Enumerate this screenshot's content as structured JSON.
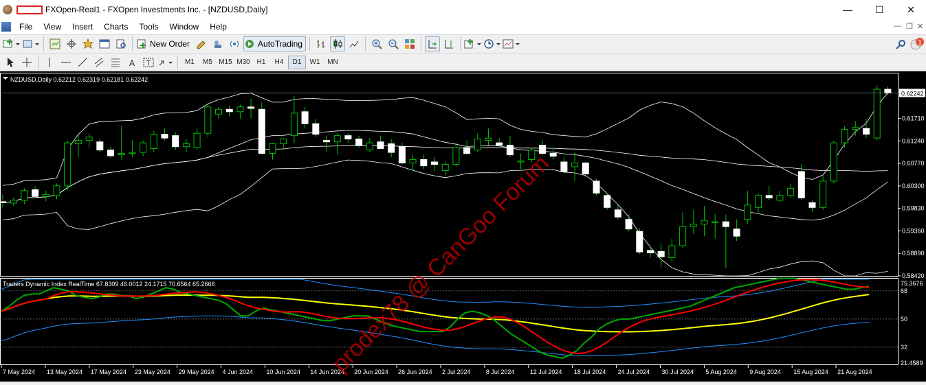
{
  "window": {
    "title": "FXOpen-Real1 - FXOpen Investments Inc. - [NZDUSD,Daily]"
  },
  "menu": [
    "File",
    "View",
    "Insert",
    "Charts",
    "Tools",
    "Window",
    "Help"
  ],
  "toolbar": {
    "new_order_label": "New Order",
    "autotrading_label": "AutoTrading",
    "notification_count": "1"
  },
  "timeframes": [
    "M1",
    "M5",
    "M15",
    "M30",
    "H1",
    "H4",
    "D1",
    "W1",
    "MN"
  ],
  "active_timeframe": "D1",
  "chart": {
    "header": "NZDUSD,Daily  0.62212 0.62319 0.62181 0.62242",
    "current_price": "0.62242",
    "price_labels": [
      "0.62242",
      "0.61710",
      "0.61240",
      "0.60770",
      "0.60300",
      "0.59830",
      "0.59360",
      "0.58890",
      "0.58420"
    ],
    "indicator_header": "Traders Dynamic Index RealTime 67.8309 46.0012 24.1715 70.6564 65.2666",
    "indicator_labels": [
      "75.3676",
      "68",
      "50",
      "32",
      "21.4589"
    ],
    "date_labels": [
      "7 May 2024",
      "13 May 2024",
      "17 May 2024",
      "23 May 2024",
      "29 May 2024",
      "4 Jun 2024",
      "10 Jun 2024",
      "14 Jun 2024",
      "20 Jun 2024",
      "26 Jun 2024",
      "2 Jul 2024",
      "8 Jul 2024",
      "12 Jul 2024",
      "18 Jul 2024",
      "24 Jul 2024",
      "30 Jul 2024",
      "5 Aug 2024",
      "9 Aug 2024",
      "15 Aug 2024",
      "21 Aug 2024"
    ],
    "watermark": "prodex78 @ CanGoo Forum",
    "colors": {
      "background": "#000000",
      "candle_bull": "#000000",
      "candle_bear": "#ffffff",
      "candle_outline": "#ffffff",
      "doji_green": "#00c000",
      "bands": "#ffffff",
      "tdi_green": "#00aa00",
      "tdi_red": "#ff0000",
      "tdi_yellow": "#ffff00",
      "tdi_blue": "#1e90ff",
      "watermark": "#cc0000"
    }
  },
  "chart_data": {
    "type": "candlestick",
    "symbol": "NZDUSD",
    "timeframe": "Daily",
    "ylim": [
      0.5842,
      0.6265
    ],
    "candles": [
      {
        "o": 0.5997,
        "h": 0.6012,
        "l": 0.5985,
        "c": 0.5995
      },
      {
        "o": 0.5994,
        "h": 0.6005,
        "l": 0.5988,
        "c": 0.6
      },
      {
        "o": 0.6,
        "h": 0.6025,
        "l": 0.5992,
        "c": 0.602
      },
      {
        "o": 0.6022,
        "h": 0.603,
        "l": 0.6005,
        "c": 0.6008
      },
      {
        "o": 0.6008,
        "h": 0.602,
        "l": 0.5998,
        "c": 0.6012
      },
      {
        "o": 0.601,
        "h": 0.6035,
        "l": 0.6002,
        "c": 0.603
      },
      {
        "o": 0.603,
        "h": 0.6125,
        "l": 0.602,
        "c": 0.612
      },
      {
        "o": 0.6118,
        "h": 0.6135,
        "l": 0.609,
        "c": 0.6125
      },
      {
        "o": 0.6125,
        "h": 0.614,
        "l": 0.611,
        "c": 0.6132
      },
      {
        "o": 0.6122,
        "h": 0.6128,
        "l": 0.61,
        "c": 0.6105
      },
      {
        "o": 0.6105,
        "h": 0.6112,
        "l": 0.6088,
        "c": 0.6093
      },
      {
        "o": 0.6095,
        "h": 0.6155,
        "l": 0.6085,
        "c": 0.6098
      },
      {
        "o": 0.6098,
        "h": 0.6125,
        "l": 0.609,
        "c": 0.61
      },
      {
        "o": 0.61,
        "h": 0.6125,
        "l": 0.6092,
        "c": 0.612
      },
      {
        "o": 0.6108,
        "h": 0.6145,
        "l": 0.61,
        "c": 0.6138
      },
      {
        "o": 0.6138,
        "h": 0.615,
        "l": 0.6125,
        "c": 0.613
      },
      {
        "o": 0.6135,
        "h": 0.6142,
        "l": 0.6105,
        "c": 0.6112
      },
      {
        "o": 0.6112,
        "h": 0.6128,
        "l": 0.61,
        "c": 0.6118
      },
      {
        "o": 0.611,
        "h": 0.615,
        "l": 0.6105,
        "c": 0.614
      },
      {
        "o": 0.614,
        "h": 0.62,
        "l": 0.6132,
        "c": 0.6195
      },
      {
        "o": 0.618,
        "h": 0.6195,
        "l": 0.617,
        "c": 0.619
      },
      {
        "o": 0.619,
        "h": 0.6198,
        "l": 0.6175,
        "c": 0.6185
      },
      {
        "o": 0.6185,
        "h": 0.62,
        "l": 0.617,
        "c": 0.6195
      },
      {
        "o": 0.6195,
        "h": 0.6212,
        "l": 0.617,
        "c": 0.6192
      },
      {
        "o": 0.619,
        "h": 0.6205,
        "l": 0.6095,
        "c": 0.6098
      },
      {
        "o": 0.6098,
        "h": 0.612,
        "l": 0.6085,
        "c": 0.6118
      },
      {
        "o": 0.6118,
        "h": 0.613,
        "l": 0.6105,
        "c": 0.6128
      },
      {
        "o": 0.6135,
        "h": 0.6218,
        "l": 0.612,
        "c": 0.6182
      },
      {
        "o": 0.6185,
        "h": 0.6195,
        "l": 0.615,
        "c": 0.616
      },
      {
        "o": 0.616,
        "h": 0.617,
        "l": 0.6132,
        "c": 0.6138
      },
      {
        "o": 0.6125,
        "h": 0.6135,
        "l": 0.61,
        "c": 0.6122
      },
      {
        "o": 0.6122,
        "h": 0.614,
        "l": 0.6095,
        "c": 0.6135
      },
      {
        "o": 0.6135,
        "h": 0.614,
        "l": 0.612,
        "c": 0.6128
      },
      {
        "o": 0.6128,
        "h": 0.6135,
        "l": 0.611,
        "c": 0.6115
      },
      {
        "o": 0.6105,
        "h": 0.613,
        "l": 0.61,
        "c": 0.612
      },
      {
        "o": 0.6122,
        "h": 0.6135,
        "l": 0.611,
        "c": 0.6108
      },
      {
        "o": 0.6118,
        "h": 0.6128,
        "l": 0.609,
        "c": 0.61
      },
      {
        "o": 0.6112,
        "h": 0.612,
        "l": 0.6075,
        "c": 0.6078
      },
      {
        "o": 0.6078,
        "h": 0.6095,
        "l": 0.606,
        "c": 0.6085
      },
      {
        "o": 0.6085,
        "h": 0.6095,
        "l": 0.6065,
        "c": 0.6072
      },
      {
        "o": 0.608,
        "h": 0.609,
        "l": 0.606,
        "c": 0.6075
      },
      {
        "o": 0.6062,
        "h": 0.608,
        "l": 0.6052,
        "c": 0.6075
      },
      {
        "o": 0.6075,
        "h": 0.612,
        "l": 0.607,
        "c": 0.611
      },
      {
        "o": 0.611,
        "h": 0.6125,
        "l": 0.6095,
        "c": 0.6098
      },
      {
        "o": 0.6105,
        "h": 0.614,
        "l": 0.61,
        "c": 0.6128
      },
      {
        "o": 0.6125,
        "h": 0.615,
        "l": 0.6115,
        "c": 0.613
      },
      {
        "o": 0.612,
        "h": 0.613,
        "l": 0.611,
        "c": 0.6115
      },
      {
        "o": 0.6115,
        "h": 0.6135,
        "l": 0.609,
        "c": 0.6095
      },
      {
        "o": 0.608,
        "h": 0.6098,
        "l": 0.6065,
        "c": 0.6082
      },
      {
        "o": 0.6085,
        "h": 0.611,
        "l": 0.608,
        "c": 0.6105
      },
      {
        "o": 0.6115,
        "h": 0.6125,
        "l": 0.6095,
        "c": 0.6098
      },
      {
        "o": 0.6098,
        "h": 0.611,
        "l": 0.6085,
        "c": 0.6092
      },
      {
        "o": 0.608,
        "h": 0.609,
        "l": 0.6055,
        "c": 0.606
      },
      {
        "o": 0.607,
        "h": 0.61,
        "l": 0.604,
        "c": 0.6078
      },
      {
        "o": 0.6078,
        "h": 0.608,
        "l": 0.605,
        "c": 0.6055
      },
      {
        "o": 0.604,
        "h": 0.6045,
        "l": 0.601,
        "c": 0.6015
      },
      {
        "o": 0.601,
        "h": 0.6015,
        "l": 0.598,
        "c": 0.5985
      },
      {
        "o": 0.598,
        "h": 0.599,
        "l": 0.596,
        "c": 0.5965
      },
      {
        "o": 0.596,
        "h": 0.597,
        "l": 0.5935,
        "c": 0.594
      },
      {
        "o": 0.5935,
        "h": 0.5942,
        "l": 0.5888,
        "c": 0.5892
      },
      {
        "o": 0.5895,
        "h": 0.5905,
        "l": 0.588,
        "c": 0.589
      },
      {
        "o": 0.5893,
        "h": 0.591,
        "l": 0.586,
        "c": 0.5882
      },
      {
        "o": 0.588,
        "h": 0.592,
        "l": 0.587,
        "c": 0.5905
      },
      {
        "o": 0.5905,
        "h": 0.5975,
        "l": 0.59,
        "c": 0.5945
      },
      {
        "o": 0.5945,
        "h": 0.598,
        "l": 0.593,
        "c": 0.595
      },
      {
        "o": 0.595,
        "h": 0.5988,
        "l": 0.5925,
        "c": 0.5958
      },
      {
        "o": 0.5955,
        "h": 0.5972,
        "l": 0.592,
        "c": 0.5955
      },
      {
        "o": 0.5955,
        "h": 0.597,
        "l": 0.5858,
        "c": 0.5945
      },
      {
        "o": 0.594,
        "h": 0.596,
        "l": 0.5915,
        "c": 0.5925
      },
      {
        "o": 0.596,
        "h": 0.602,
        "l": 0.595,
        "c": 0.599
      },
      {
        "o": 0.5985,
        "h": 0.6015,
        "l": 0.5975,
        "c": 0.601
      },
      {
        "o": 0.601,
        "h": 0.603,
        "l": 0.6,
        "c": 0.6005
      },
      {
        "o": 0.6,
        "h": 0.602,
        "l": 0.5995,
        "c": 0.601
      },
      {
        "o": 0.601,
        "h": 0.6035,
        "l": 0.6005,
        "c": 0.6025
      },
      {
        "o": 0.606,
        "h": 0.6075,
        "l": 0.6,
        "c": 0.6005
      },
      {
        "o": 0.5995,
        "h": 0.6,
        "l": 0.5975,
        "c": 0.5985
      },
      {
        "o": 0.5985,
        "h": 0.605,
        "l": 0.598,
        "c": 0.604
      },
      {
        "o": 0.604,
        "h": 0.6125,
        "l": 0.6035,
        "c": 0.612
      },
      {
        "o": 0.612,
        "h": 0.6155,
        "l": 0.611,
        "c": 0.6148
      },
      {
        "o": 0.6148,
        "h": 0.6165,
        "l": 0.6135,
        "c": 0.6152
      },
      {
        "o": 0.615,
        "h": 0.617,
        "l": 0.613,
        "c": 0.6138
      },
      {
        "o": 0.613,
        "h": 0.624,
        "l": 0.6125,
        "c": 0.6232
      },
      {
        "o": 0.6232,
        "h": 0.6238,
        "l": 0.622,
        "c": 0.6224
      }
    ],
    "tdi": {
      "ylim": [
        21.4589,
        75.3676
      ],
      "levels": [
        68,
        50,
        32
      ],
      "series": [
        {
          "name": "green",
          "values": [
            55,
            58,
            62,
            65,
            66,
            66,
            68,
            70,
            69,
            68,
            65,
            64,
            63,
            64,
            66,
            66,
            65,
            65,
            63,
            64,
            66,
            68,
            70,
            69,
            67,
            66,
            65,
            64,
            63,
            62,
            60,
            56,
            52,
            52,
            55,
            57,
            56,
            55,
            54,
            53,
            52,
            51,
            50,
            49,
            49,
            50,
            51,
            52,
            52,
            52,
            50,
            48,
            46,
            45,
            44,
            43,
            42,
            42,
            42,
            42,
            45,
            50,
            54,
            55,
            54,
            52,
            49,
            45,
            41,
            38,
            35,
            32,
            29,
            27,
            26,
            25,
            27,
            30,
            35,
            39,
            44,
            47,
            49,
            50,
            50,
            51,
            52,
            53,
            54,
            55,
            56,
            57,
            58,
            60,
            62,
            64,
            66,
            68,
            70,
            71,
            72,
            73,
            74,
            75,
            76,
            76,
            76,
            75,
            74,
            73,
            72,
            71,
            70,
            69,
            69,
            70,
            71
          ]
        }
      ]
    }
  }
}
